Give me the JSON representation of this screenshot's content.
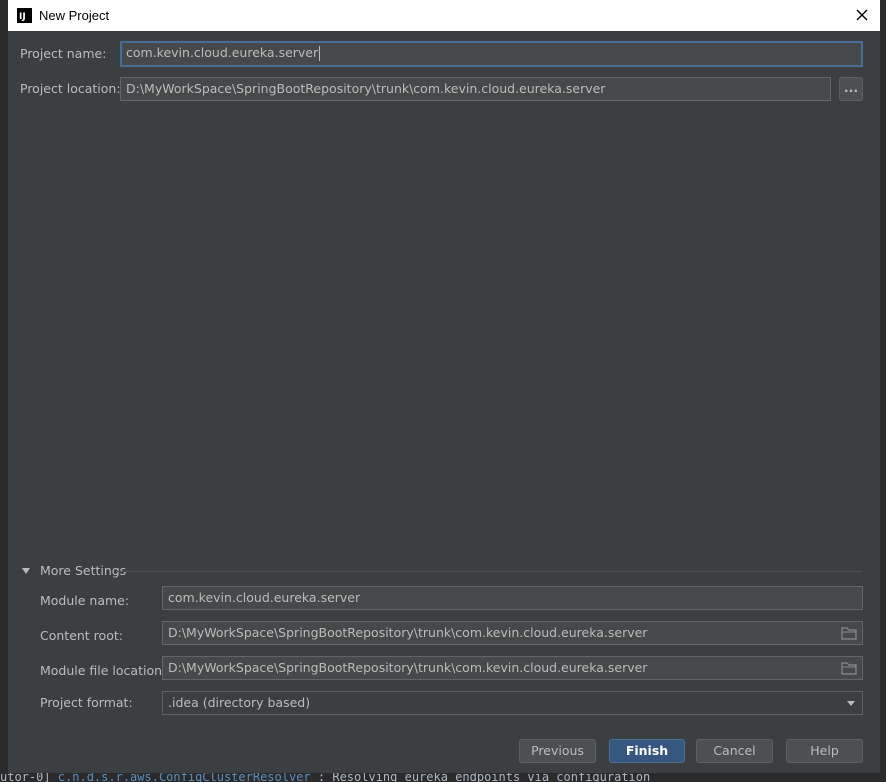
{
  "background": {
    "console_text_a": "utor-0] ",
    "console_pkg": "c.n.d.s.r.aws.ConfigClusterResolver",
    "console_text_b": "     : Resolving eureka endpoints via configuration"
  },
  "window": {
    "title": "New Project",
    "icon_text": "IJ"
  },
  "project": {
    "name_label": "Project name:",
    "name_value": "com.kevin.cloud.eureka.server",
    "location_label": "Project location:",
    "location_value": "D:\\MyWorkSpace\\SpringBootRepository\\trunk\\com.kevin.cloud.eureka.server",
    "browse_label": "..."
  },
  "more_settings": {
    "title": "More Settings",
    "module_name_label": "Module name:",
    "module_name_value": "com.kevin.cloud.eureka.server",
    "content_root_label": "Content root:",
    "content_root_value": "D:\\MyWorkSpace\\SpringBootRepository\\trunk\\com.kevin.cloud.eureka.server",
    "module_file_label": "Module file location:",
    "module_file_value": "D:\\MyWorkSpace\\SpringBootRepository\\trunk\\com.kevin.cloud.eureka.server",
    "format_label": "Project format:",
    "format_value": ".idea (directory based)"
  },
  "buttons": {
    "previous": "Previous",
    "finish": "Finish",
    "cancel": "Cancel",
    "help": "Help"
  },
  "colors": {
    "dialog_bg": "#3c3f41",
    "field_bg": "#45494a",
    "focus_border": "#466d94",
    "primary_button": "#365880"
  }
}
